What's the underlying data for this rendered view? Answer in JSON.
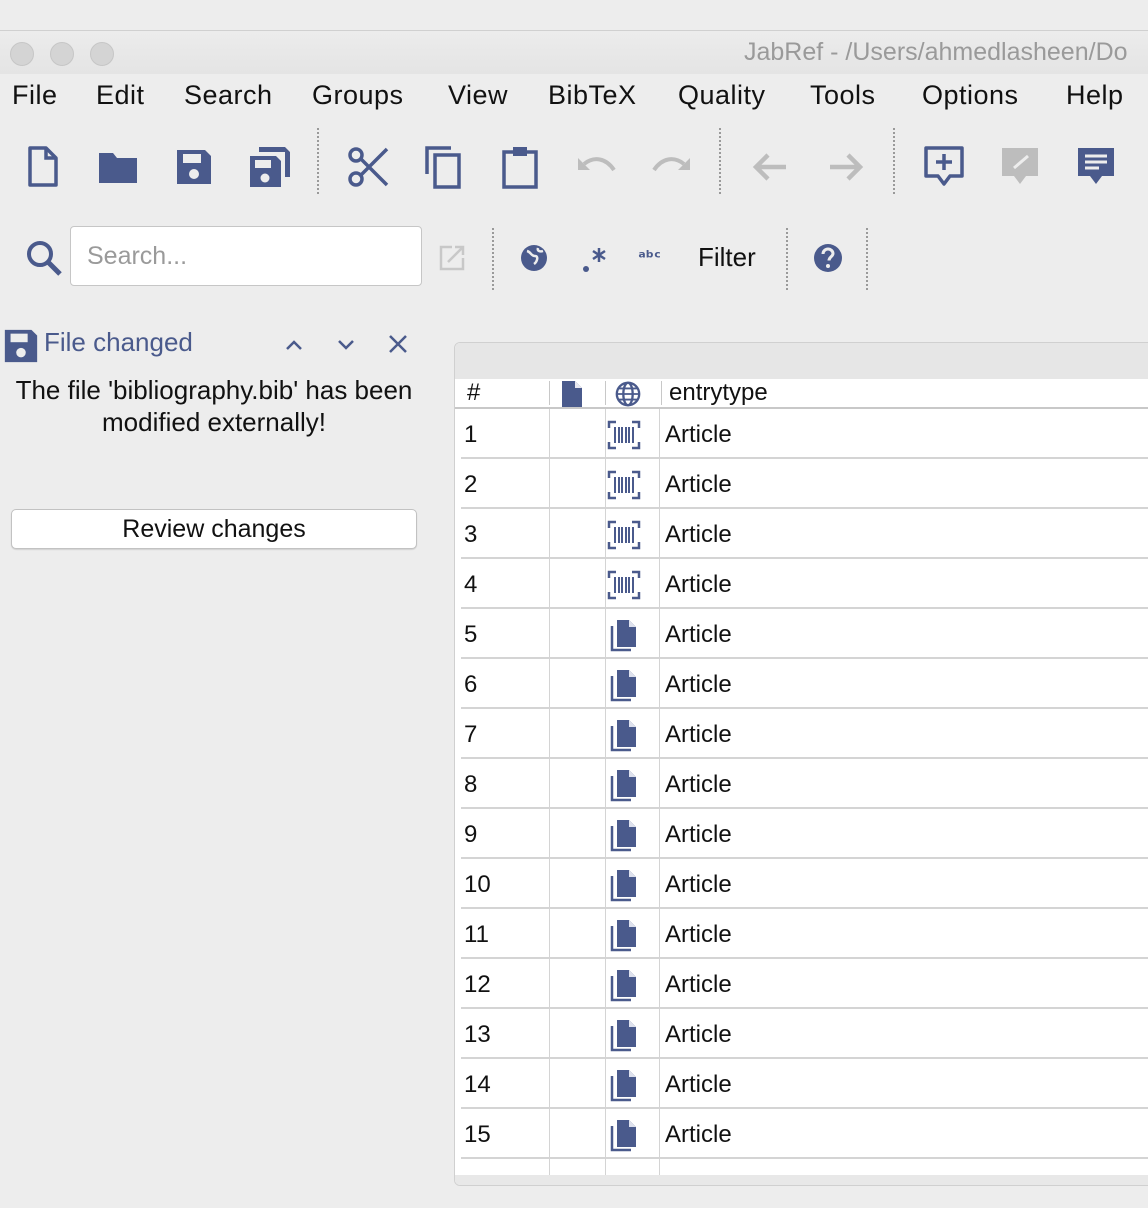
{
  "window": {
    "title": "JabRef - /Users/ahmedlasheen/Do"
  },
  "menubar": {
    "items": [
      "File",
      "Edit",
      "Search",
      "Groups",
      "View",
      "BibTeX",
      "Quality",
      "Tools",
      "Options",
      "Help"
    ]
  },
  "toolbar": {
    "buttons": [
      "new-library-icon",
      "open-library-icon",
      "save-icon",
      "save-all-icon",
      "cut-icon",
      "copy-icon",
      "paste-icon",
      "undo-icon",
      "redo-icon",
      "back-icon",
      "forward-icon",
      "new-entry-icon",
      "new-entry-from-plaintext-icon",
      "push-to-application-icon"
    ],
    "accent_color": "#4a5a8c",
    "disabled_color": "#bdbdbd"
  },
  "search": {
    "placeholder": "Search...",
    "value": "",
    "filter_label": "Filter"
  },
  "notification": {
    "title": "File changed",
    "message": "The file 'bibliography.bib' has been modified externally!",
    "review_button": "Review changes"
  },
  "table": {
    "headers": {
      "number": "#",
      "entrytype": "entrytype"
    },
    "rows": [
      {
        "num": "1",
        "icon": "barcode-icon",
        "type": "Article"
      },
      {
        "num": "2",
        "icon": "barcode-icon",
        "type": "Article"
      },
      {
        "num": "3",
        "icon": "barcode-icon",
        "type": "Article"
      },
      {
        "num": "4",
        "icon": "barcode-icon",
        "type": "Article"
      },
      {
        "num": "5",
        "icon": "file-icon",
        "type": "Article"
      },
      {
        "num": "6",
        "icon": "file-icon",
        "type": "Article"
      },
      {
        "num": "7",
        "icon": "file-icon",
        "type": "Article"
      },
      {
        "num": "8",
        "icon": "file-icon",
        "type": "Article"
      },
      {
        "num": "9",
        "icon": "file-icon",
        "type": "Article"
      },
      {
        "num": "10",
        "icon": "file-icon",
        "type": "Article"
      },
      {
        "num": "11",
        "icon": "file-icon",
        "type": "Article"
      },
      {
        "num": "12",
        "icon": "file-icon",
        "type": "Article"
      },
      {
        "num": "13",
        "icon": "file-icon",
        "type": "Article"
      },
      {
        "num": "14",
        "icon": "file-icon",
        "type": "Article"
      },
      {
        "num": "15",
        "icon": "file-icon",
        "type": "Article"
      }
    ]
  }
}
